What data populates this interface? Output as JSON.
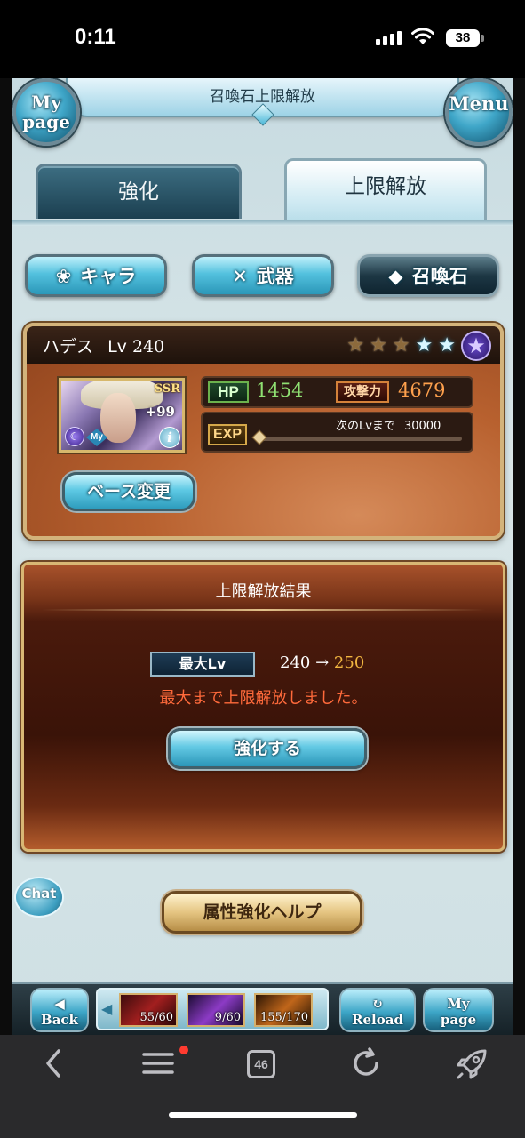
{
  "status_bar": {
    "time": "0:11",
    "battery": "38"
  },
  "header": {
    "title": "召喚石上限解放",
    "mypage_line1": "My",
    "mypage_line2": "page",
    "menu_label": "Menu"
  },
  "tabs": [
    {
      "label": "強化",
      "active": false
    },
    {
      "label": "上限解放",
      "active": true
    }
  ],
  "filters": [
    {
      "label": "キャラ",
      "icon": "character-icon",
      "active": false
    },
    {
      "label": "武器",
      "icon": "weapon-icon",
      "active": false
    },
    {
      "label": "召喚石",
      "icon": "summon-crystal-icon",
      "active": true
    }
  ],
  "summon": {
    "name": "ハデス",
    "level_label": "Lv",
    "level": "240",
    "rarity_badge": "SSR",
    "plus": "+99",
    "my_badge": "My",
    "stars": {
      "filled_bronze": 3,
      "filled_blue": 2,
      "special": 1
    },
    "hp_label": "HP",
    "hp": "1454",
    "atk_label": "攻撃力",
    "atk": "4679",
    "exp_label": "EXP",
    "next_lv_label": "次のLvまで",
    "next_lv_value": "30000",
    "exp_progress": 0,
    "base_change_label": "ベース変更"
  },
  "result": {
    "title": "上限解放結果",
    "max_lv_label": "最大Lv",
    "old_lv": "240",
    "arrow": "→",
    "new_lv": "250",
    "message": "最大まで上限解放しました。",
    "enhance_label": "強化する"
  },
  "chat_label": "Chat",
  "help_label": "属性強化ヘルプ",
  "game_bar": {
    "back_line1": "◀",
    "back_line2": "Back",
    "items": [
      {
        "value": "55/60",
        "color": "#a21f1f"
      },
      {
        "value": "9/60",
        "color": "#8c3bc5"
      },
      {
        "value": "155/170",
        "color": "#c0661a"
      }
    ],
    "reload_line1": "↻",
    "reload_line2": "Reload",
    "mypage_line1": "My",
    "mypage_line2": "page"
  },
  "browser": {
    "tab_count": "46"
  }
}
